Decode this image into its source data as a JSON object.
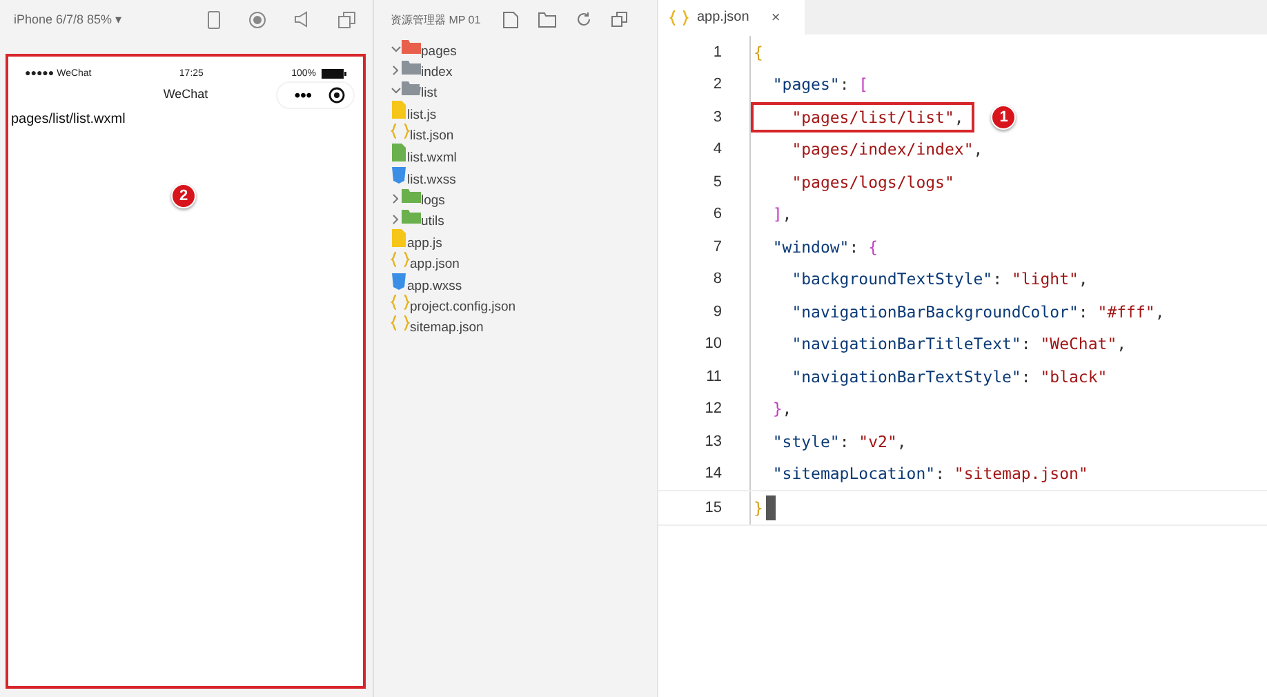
{
  "simulator": {
    "device": "iPhone 6/7/8 85%",
    "caret": "▾",
    "status_bar": {
      "signal": "●●●●● WeChat",
      "time": "17:25",
      "battery": "100%"
    },
    "nav_title": "WeChat",
    "capsule_dots": "•••",
    "page_text": "pages/list/list.wxml",
    "callout": "2"
  },
  "explorer": {
    "title": "资源管理器 MP 01",
    "tree": [
      {
        "label": "pages",
        "kind": "folder-red",
        "expanded": true,
        "children": [
          {
            "label": "index",
            "kind": "folder",
            "expanded": false
          },
          {
            "label": "list",
            "kind": "folder-open",
            "expanded": true,
            "children": [
              {
                "label": "list.js",
                "kind": "js"
              },
              {
                "label": "list.json",
                "kind": "json"
              },
              {
                "label": "list.wxml",
                "kind": "wxml"
              },
              {
                "label": "list.wxss",
                "kind": "wxss"
              }
            ]
          },
          {
            "label": "logs",
            "kind": "folder-green",
            "expanded": false
          }
        ]
      },
      {
        "label": "utils",
        "kind": "folder-green",
        "expanded": false
      },
      {
        "label": "app.js",
        "kind": "js"
      },
      {
        "label": "app.json",
        "kind": "json"
      },
      {
        "label": "app.wxss",
        "kind": "wxss"
      },
      {
        "label": "project.config.json",
        "kind": "json"
      },
      {
        "label": "sitemap.json",
        "kind": "json"
      }
    ]
  },
  "editor": {
    "tab": {
      "label": "app.json",
      "close": "×"
    },
    "lines": [
      {
        "number": "1",
        "current": false,
        "tokens": [
          {
            "kind": "brace",
            "text": "{"
          }
        ]
      },
      {
        "number": "2",
        "current": false,
        "tokens": [
          {
            "kind": "key",
            "text": "  \"pages\""
          },
          {
            "kind": "punct",
            "text": ": "
          },
          {
            "kind": "bracket",
            "text": "["
          }
        ]
      },
      {
        "number": "3",
        "current": false,
        "highlight": "1",
        "tokens": [
          {
            "kind": "string",
            "text": "    \"pages/list/list\""
          },
          {
            "kind": "punct",
            "text": ","
          }
        ]
      },
      {
        "number": "4",
        "current": false,
        "tokens": [
          {
            "kind": "string",
            "text": "    \"pages/index/index\""
          },
          {
            "kind": "punct",
            "text": ","
          }
        ]
      },
      {
        "number": "5",
        "current": false,
        "tokens": [
          {
            "kind": "string",
            "text": "    \"pages/logs/logs\""
          }
        ]
      },
      {
        "number": "6",
        "current": false,
        "tokens": [
          {
            "kind": "bracket",
            "text": "  ]"
          },
          {
            "kind": "punct",
            "text": ","
          }
        ]
      },
      {
        "number": "7",
        "current": false,
        "tokens": [
          {
            "kind": "key",
            "text": "  \"window\""
          },
          {
            "kind": "punct",
            "text": ": "
          },
          {
            "kind": "bracket",
            "text": "{"
          }
        ]
      },
      {
        "number": "8",
        "current": false,
        "tokens": [
          {
            "kind": "key",
            "text": "    \"backgroundTextStyle\""
          },
          {
            "kind": "punct",
            "text": ": "
          },
          {
            "kind": "string",
            "text": "\"light\""
          },
          {
            "kind": "punct",
            "text": ","
          }
        ]
      },
      {
        "number": "9",
        "current": false,
        "tokens": [
          {
            "kind": "key",
            "text": "    \"navigationBarBackgroundColor\""
          },
          {
            "kind": "punct",
            "text": ": "
          },
          {
            "kind": "string",
            "text": "\"#fff\""
          },
          {
            "kind": "punct",
            "text": ","
          }
        ]
      },
      {
        "number": "10",
        "current": false,
        "tokens": [
          {
            "kind": "key",
            "text": "    \"navigationBarTitleText\""
          },
          {
            "kind": "punct",
            "text": ": "
          },
          {
            "kind": "string",
            "text": "\"WeChat\""
          },
          {
            "kind": "punct",
            "text": ","
          }
        ]
      },
      {
        "number": "11",
        "current": false,
        "tokens": [
          {
            "kind": "key",
            "text": "    \"navigationBarTextStyle\""
          },
          {
            "kind": "punct",
            "text": ": "
          },
          {
            "kind": "string",
            "text": "\"black\""
          }
        ]
      },
      {
        "number": "12",
        "current": false,
        "tokens": [
          {
            "kind": "bracket",
            "text": "  }"
          },
          {
            "kind": "punct",
            "text": ","
          }
        ]
      },
      {
        "number": "13",
        "current": false,
        "tokens": [
          {
            "kind": "key",
            "text": "  \"style\""
          },
          {
            "kind": "punct",
            "text": ": "
          },
          {
            "kind": "string",
            "text": "\"v2\""
          },
          {
            "kind": "punct",
            "text": ","
          }
        ]
      },
      {
        "number": "14",
        "current": false,
        "tokens": [
          {
            "kind": "key",
            "text": "  \"sitemapLocation\""
          },
          {
            "kind": "punct",
            "text": ": "
          },
          {
            "kind": "string",
            "text": "\"sitemap.json\""
          }
        ]
      },
      {
        "number": "15",
        "current": true,
        "tokens": [
          {
            "kind": "brace",
            "text": "}"
          }
        ]
      }
    ]
  }
}
